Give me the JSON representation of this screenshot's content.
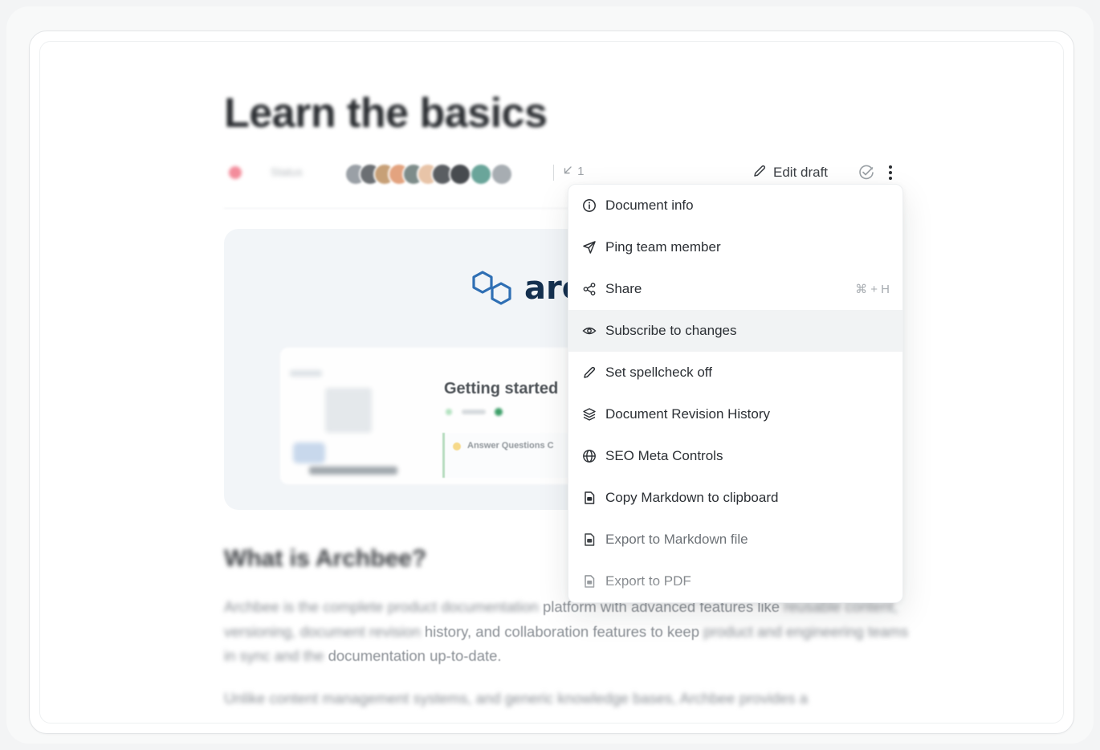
{
  "document": {
    "title": "Learn the basics",
    "status_label": "Status",
    "backlinks_count": "1",
    "edit_draft_label": "Edit draft",
    "section_heading": "What is Archbee?",
    "paragraph_1": {
      "hidden": "Archbee is the complete product documentation",
      "visible": "platform with advanced features like",
      "hidden_2": "reusable content, versioning, document revision",
      "visible_2": "history, and collaboration features to keep",
      "hidden_3": "product and engineering teams in sync and the",
      "visible_3": "documentation up-to-date."
    },
    "paragraph_2": "Unlike content management systems, and generic knowledge bases, Archbee provides a"
  },
  "hero": {
    "logo_text": "arc",
    "getting_started": "Getting started",
    "answer_title": "Answer Questions C"
  },
  "menu": {
    "items": [
      {
        "label": "Document info",
        "icon": "info-icon"
      },
      {
        "label": "Ping team member",
        "icon": "send-icon"
      },
      {
        "label": "Share",
        "icon": "share-icon",
        "shortcut": "⌘ + H"
      },
      {
        "label": "Subscribe to changes",
        "icon": "eye-icon"
      },
      {
        "label": "Set spellcheck off",
        "icon": "pencil-icon"
      },
      {
        "label": "Document Revision History",
        "icon": "layers-icon"
      },
      {
        "label": "SEO Meta Controls",
        "icon": "globe-icon"
      },
      {
        "label": "Copy Markdown to clipboard",
        "icon": "markdown-file-icon"
      },
      {
        "label": "Export to Markdown file",
        "icon": "markdown-file-icon"
      },
      {
        "label": "Export to PDF",
        "icon": "pdf-file-icon"
      }
    ],
    "highlighted_item": "Subscribe to changes"
  },
  "colors": {
    "accent_status": "#f38c9b",
    "logo_blue": "#2f6fb4",
    "menu_hover": "#f1f3f4"
  }
}
